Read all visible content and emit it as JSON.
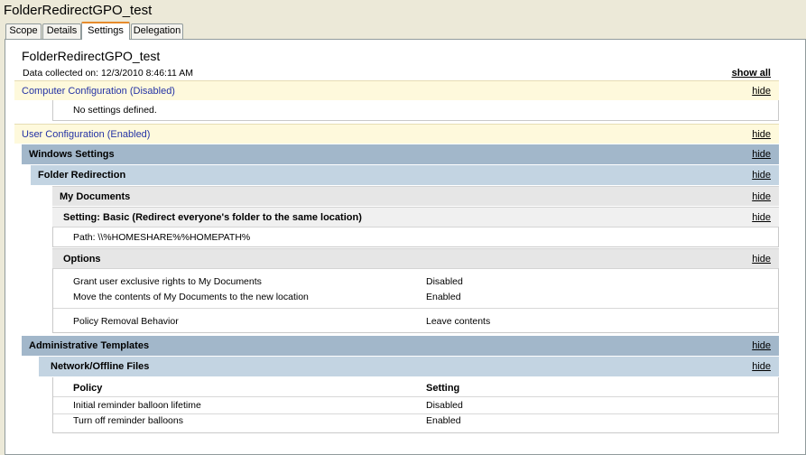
{
  "window": {
    "title": "FolderRedirectGPO_test"
  },
  "tabs": [
    {
      "label": "Scope"
    },
    {
      "label": "Details"
    },
    {
      "label": "Settings",
      "active": true
    },
    {
      "label": "Delegation"
    }
  ],
  "report": {
    "name": "FolderRedirectGPO_test",
    "collected": "Data collected on: 12/3/2010 8:46:11 AM",
    "show_all": "show all",
    "hide": "hide"
  },
  "computer": {
    "header": "Computer Configuration (Disabled)",
    "no_settings": "No settings defined."
  },
  "user": {
    "header": "User Configuration (Enabled)",
    "windows_settings": "Windows Settings",
    "folder_redirection": "Folder Redirection",
    "my_documents": "My Documents",
    "setting": "Setting: Basic (Redirect everyone's folder to the same location)",
    "path": "Path: \\\\%HOMESHARE%%HOMEPATH%",
    "options": "Options",
    "option_rows": [
      {
        "name": "Grant user exclusive rights to My Documents",
        "value": "Disabled"
      },
      {
        "name": "Move the contents of My Documents to the new location",
        "value": "Enabled"
      },
      {
        "name": "Policy Removal Behavior",
        "value": "Leave contents"
      }
    ],
    "admin_templates": "Administrative Templates",
    "network_offline": "Network/Offline Files",
    "policy_header": "Policy",
    "setting_header": "Setting",
    "policy_rows": [
      {
        "name": "Initial reminder balloon lifetime",
        "value": "Disabled"
      },
      {
        "name": "Turn off reminder balloons",
        "value": "Enabled"
      }
    ]
  }
}
